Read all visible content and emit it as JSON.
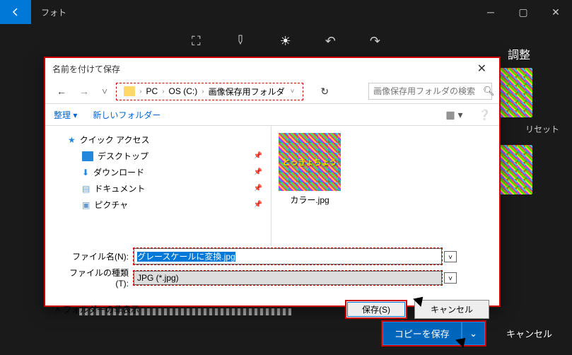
{
  "app": {
    "title": "フォト"
  },
  "side": {
    "title": "調整",
    "reset": "リセット"
  },
  "footer": {
    "save_copy": "コピーを保存",
    "cancel": "キャンセル"
  },
  "dialog": {
    "title": "名前を付けて保存",
    "breadcrumb": [
      "PC",
      "OS (C:)",
      "画像保存用フォルダ"
    ],
    "search_placeholder": "画像保存用フォルダの検索",
    "toolbar": {
      "organize": "整理",
      "new_folder": "新しいフォルダー"
    },
    "tree": {
      "quick_access": "クイック アクセス",
      "desktop": "デスクトップ",
      "downloads": "ダウンロード",
      "documents": "ドキュメント",
      "pictures": "ピクチャ"
    },
    "files": [
      {
        "name": "カラー.jpg",
        "thumb_text": "とっきょちょう"
      }
    ],
    "fields": {
      "filename_label": "ファイル名(N):",
      "filename_value": "グレースケールに変換.jpg",
      "filetype_label": "ファイルの種類(T):",
      "filetype_value": "JPG (*.jpg)"
    },
    "hide_folders": "フォルダーの非表示",
    "save_btn": "保存(S)",
    "cancel_btn": "キャンセル"
  }
}
